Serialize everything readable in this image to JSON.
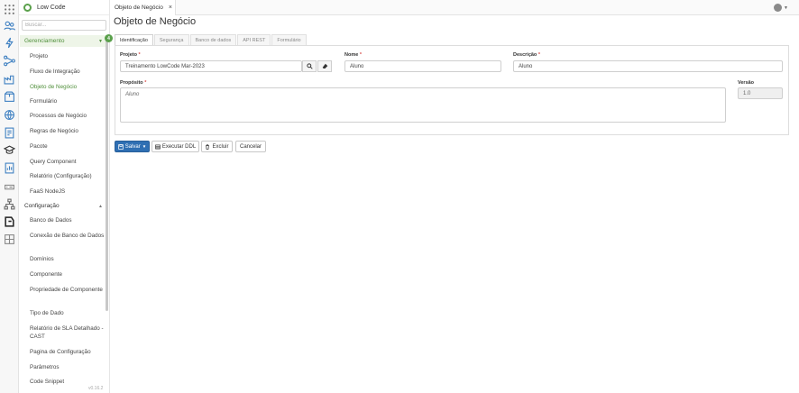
{
  "app": {
    "name": "Low Code",
    "version": "v0.16.2"
  },
  "nav": {
    "search_placeholder": "Buscar...",
    "badge": "4",
    "sections": [
      {
        "label": "Gerenciamento"
      },
      {
        "label": "Configuração"
      }
    ],
    "management_items": [
      {
        "label": "Projeto"
      },
      {
        "label": "Fluxo de Integração"
      },
      {
        "label": "Objeto de Negócio"
      },
      {
        "label": "Formulário"
      },
      {
        "label": "Processos de Negócio"
      },
      {
        "label": "Regras de Negócio"
      },
      {
        "label": "Pacote"
      },
      {
        "label": "Query Component"
      },
      {
        "label": "Relatório (Configuração)"
      },
      {
        "label": "FaaS NodeJS"
      }
    ],
    "config_items": [
      {
        "label": "Banco de Dados"
      },
      {
        "label": "Conexão de Banco de Dados"
      },
      {
        "label": "Domínios"
      },
      {
        "label": "Componente"
      },
      {
        "label": "Propriedade de Componente"
      },
      {
        "label": "Tipo de Dado"
      },
      {
        "label": "Relatório de SLA Detalhado - CAST"
      },
      {
        "label": "Pagina de Configuração"
      },
      {
        "label": "Parâmetros"
      },
      {
        "label": "Code Snippet"
      }
    ]
  },
  "topbar": {
    "tab_label": "Objeto de Negócio",
    "close_glyph": "×"
  },
  "page": {
    "title": "Objeto de Negócio"
  },
  "subtabs": [
    "Identificação",
    "Segurança",
    "Banco de dados",
    "API REST",
    "Formulário"
  ],
  "form": {
    "projeto": {
      "label": "Projeto",
      "value": "Treinamento LowCode Mar-2023"
    },
    "nome": {
      "label": "Nome",
      "value": "Aluno"
    },
    "descricao": {
      "label": "Descrição",
      "value": "Aluno"
    },
    "proposito": {
      "label": "Propósito",
      "value": "Aluno"
    },
    "versao": {
      "label": "Versão",
      "value": "1.0"
    },
    "required_mark": "*"
  },
  "actions": {
    "save": "Salvar",
    "execute_ddl": "Executar DDL",
    "delete": "Excluir",
    "cancel": "Cancelar"
  },
  "colors": {
    "accent": "#5aa04b",
    "primary": "#2f6fb3",
    "required": "#d9534f"
  }
}
